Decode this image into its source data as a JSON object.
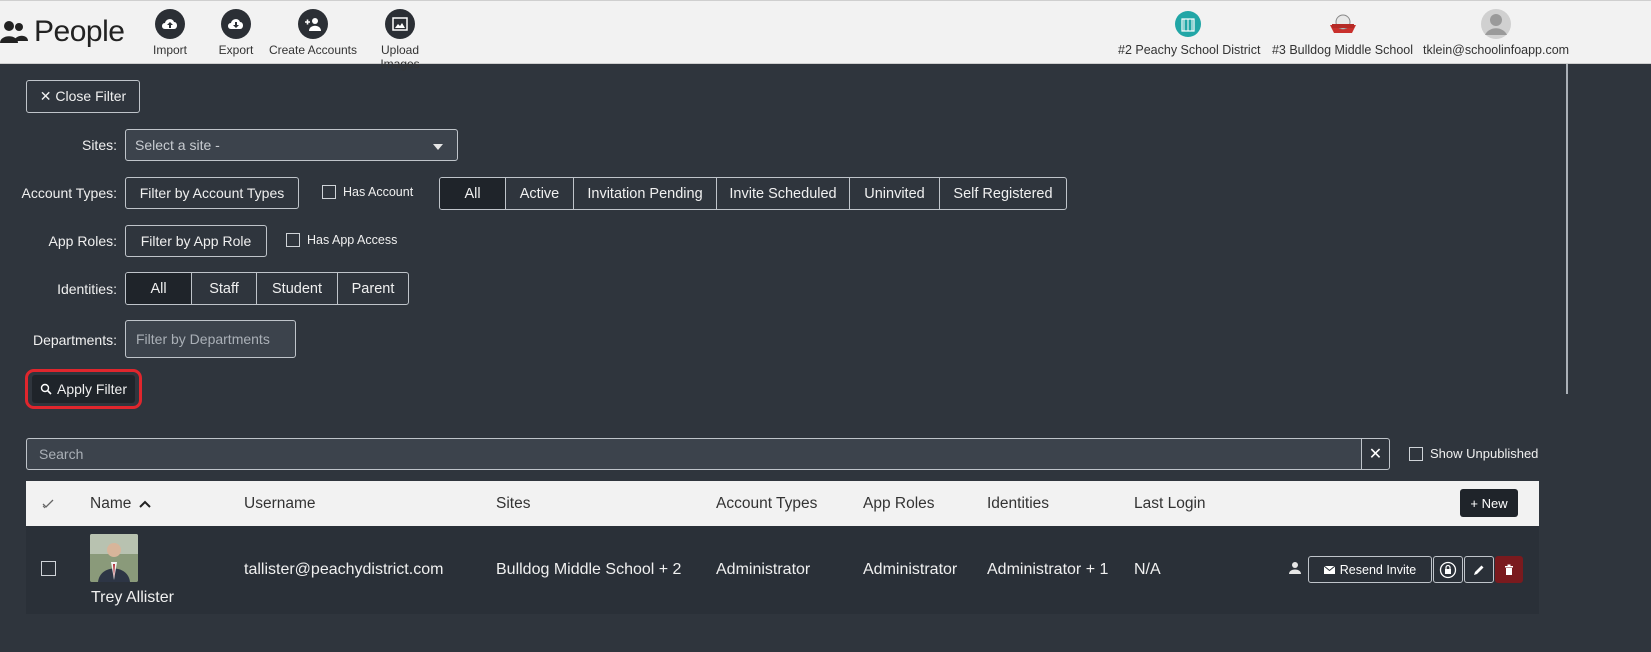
{
  "header": {
    "title": "People",
    "tools": [
      {
        "label": "Import",
        "icon": "cloud-upload-icon"
      },
      {
        "label": "Export",
        "icon": "cloud-download-icon"
      },
      {
        "label": "Create Accounts",
        "icon": "add-user-icon"
      },
      {
        "label": "Upload Images",
        "icon": "image-icon"
      }
    ],
    "sites": [
      {
        "label": "#2 Peachy School District",
        "icon": "district-logo"
      },
      {
        "label": "#3 Bulldog Middle School",
        "icon": "school-logo"
      },
      {
        "label": "tklein@schoolinfoapp.com",
        "icon": "avatar-icon"
      }
    ]
  },
  "filter": {
    "close_label": "✕ Close Filter",
    "sites_label": "Sites:",
    "sites_select": "Select a site -",
    "account_types_label": "Account Types:",
    "account_types_button": "Filter by Account Types",
    "has_account": "Has Account",
    "account_status": [
      "All",
      "Active",
      "Invitation Pending",
      "Invite Scheduled",
      "Uninvited",
      "Self Registered"
    ],
    "account_status_selected": "All",
    "app_roles_label": "App Roles:",
    "app_roles_button": "Filter by App Role",
    "has_app_access": "Has App Access",
    "identities_label": "Identities:",
    "identities": [
      "All",
      "Staff",
      "Student",
      "Parent"
    ],
    "identities_selected": "All",
    "departments_label": "Departments:",
    "departments_placeholder": "Filter by Departments",
    "apply_label": "Apply Filter"
  },
  "search": {
    "placeholder": "Search",
    "clear": "✕",
    "show_unpublished": "Show Unpublished"
  },
  "table": {
    "columns": [
      "Name",
      "Username",
      "Sites",
      "Account Types",
      "App Roles",
      "Identities",
      "Last Login"
    ],
    "new_label": "+ New",
    "rows": [
      {
        "name": "Trey Allister",
        "username": "tallister@peachydistrict.com",
        "sites": "Bulldog Middle School + 2",
        "account_types": "Administrator",
        "app_roles": "Administrator",
        "identities": "Administrator + 1",
        "last_login": "N/A",
        "resend_label": "Resend Invite"
      }
    ]
  },
  "colors": {
    "background": "#2f353d",
    "topbar": "#f2f2f2",
    "highlight": "#e0262d",
    "delete": "#7a1a1e"
  }
}
